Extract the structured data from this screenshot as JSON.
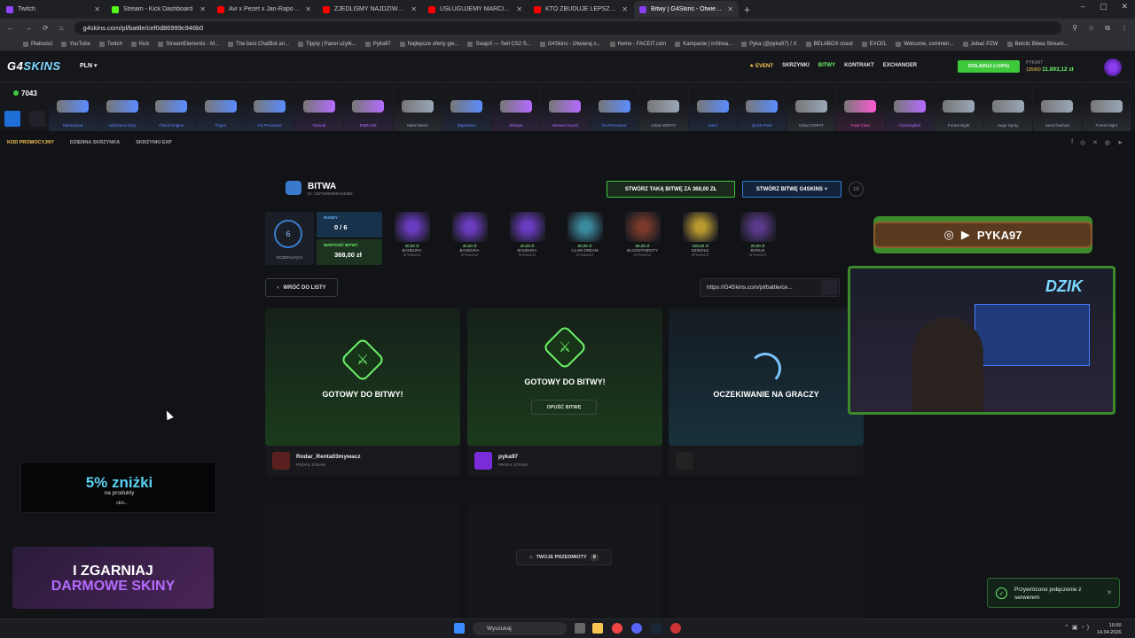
{
  "browser": {
    "tabs": [
      {
        "label": "Twitch",
        "color": "#9146ff",
        "active": false
      },
      {
        "label": "Stream - Kick Dashboard",
        "color": "#53fc18",
        "active": false
      },
      {
        "label": "Avi x Pezet x Jan-Rapowanie",
        "color": "#ff0000",
        "active": false
      },
      {
        "label": "ZJEDLIŚMY NAJDZIWNIEJSZA",
        "color": "#ff0000",
        "active": false
      },
      {
        "label": "USŁUGUJEMY MARCINOWI NA",
        "color": "#ff0000",
        "active": false
      },
      {
        "label": "KTO ZBUDUJE LEPSZĄ RZECZ",
        "color": "#ff0000",
        "active": false
      },
      {
        "label": "Bitwy | G4Skins - Otwieraj skrz",
        "color": "#8a3cf0",
        "active": true
      }
    ],
    "url": "g4skins.com/pl/battle/cef0d86999c946b0",
    "bookmarks": [
      "Płatności",
      "YouTube",
      "Twitch",
      "Kick",
      "StreamElements - M...",
      "The best ChatBot an...",
      "Tipply | Panel użytk...",
      "Pyka97",
      "Najlepsze oferty gie...",
      "SwapX — Sell CS2 S...",
      "G4Skins - Otwieraj s...",
      "Home - FACEIT.com",
      "Kampanie | inStrea...",
      "Pyka (@pyka97) / X",
      "BELABOX cloud",
      "EXCEL",
      "Welcome, commen...",
      "Jebać PZW",
      "Betclic Bitwa Stream..."
    ]
  },
  "site": {
    "logo_a": "G4",
    "logo_b": "SKINS",
    "currency": "PLN ▾",
    "nav": {
      "event": "★ EVENT",
      "cases": "SKRZYNKI",
      "battles": "BITWY",
      "contracts": "KONTRAKT",
      "exchanger": "EXCHANGER"
    },
    "topup": "DOŁADUJ (+10%)",
    "user": {
      "name": "PYKA97",
      "points": "135960",
      "balance": "11.893,12 zł"
    },
    "online": "7043",
    "ticker_items": [
      {
        "name": "Memorized",
        "color": "#5a8cff"
      },
      {
        "name": "VariCamo Grey",
        "color": "#5a8cff"
      },
      {
        "name": "Check Engine",
        "color": "#5a8cff"
      },
      {
        "name": "Trigon",
        "color": "#5a8cff"
      },
      {
        "name": "Co-Processor",
        "color": "#5a8cff"
      },
      {
        "name": "Tactical",
        "color": "#b56bff"
      },
      {
        "name": "ENRAGE",
        "color": "#b56bff"
      },
      {
        "name": "Safari Mesh",
        "color": "#9aa7b8"
      },
      {
        "name": "Slipstream",
        "color": "#5a8cff"
      },
      {
        "name": "Sharpie",
        "color": "#b56bff"
      },
      {
        "name": "Heaven Guard",
        "color": "#b56bff"
      },
      {
        "name": "Co-Processor",
        "color": "#5a8cff"
      },
      {
        "name": "Urban DDPAT",
        "color": "#9aa7b8"
      },
      {
        "name": "Kami",
        "color": "#5a8cff"
      },
      {
        "name": "Quick Peek",
        "color": "#5a8cff"
      },
      {
        "name": "Urban DDPAT",
        "color": "#9aa7b8"
      },
      {
        "name": "Fowl Clow",
        "color": "#ff5ad6"
      },
      {
        "name": "Clockingbird",
        "color": "#b56bff"
      },
      {
        "name": "Forest Night",
        "color": "#9aa7b8"
      },
      {
        "name": "Sage Spray",
        "color": "#9aa7b8"
      },
      {
        "name": "Sand Dashed",
        "color": "#9aa7b8"
      },
      {
        "name": "Forest Night",
        "color": "#9aa7b8"
      }
    ],
    "subnav": {
      "promo": "KOD PROMOCYJNY",
      "daily": "DZIENNA SKRZYNKA",
      "exp": "SKRZYNKI EXP"
    }
  },
  "battle": {
    "title": "BITWA",
    "id": "ID: CEF0D86999C946B0",
    "create_same": "STWÓRZ TAKĄ BITWĘ ZA 368,00 ZŁ",
    "create_g4": "STWÓRZ BITWĘ G4SKINS +",
    "age_badge": "18",
    "status": "OCZEKUJĄCA",
    "status_num": "6",
    "rounds_label": "RUNDY",
    "rounds_value": "0 / 6",
    "value_label": "WARTOŚĆ BITWY",
    "value_value": "368,00 zł",
    "cases": [
      {
        "name": "BANDURA",
        "price": "40,00 zł",
        "color": "#6a3cc0"
      },
      {
        "name": "BANDURA",
        "price": "40,00 zł",
        "color": "#6a3cc0"
      },
      {
        "name": "BANDURA",
        "price": "40,00 zł",
        "color": "#6a3cc0"
      },
      {
        "name": "CLAW DREAM",
        "price": "60,00 zł",
        "color": "#3a8a9c"
      },
      {
        "name": "BLOODTHIRSTY",
        "price": "68,00 zł",
        "color": "#7a3a2a"
      },
      {
        "name": "DZINOLD",
        "price": "100,00 zł",
        "color": "#b89a30"
      },
      {
        "name": "BONUS",
        "price": "20,00 zł",
        "color": "#5a3a8a"
      }
    ],
    "check_label": "SPRAWDŹ",
    "back": "WRÓĆ DO LISTY",
    "link": "https://G4Skins.com/pl/battle/ce...",
    "slots": [
      {
        "title": "GOTOWY DO BITWY!",
        "player": "Rodar_Renta03mywacz",
        "profile": "PROFIL STEAM"
      },
      {
        "title": "GOTOWY DO BITWY!",
        "player": "pyka97",
        "profile": "PROFIL STEAM",
        "leave": "OPUŚĆ BITWĘ"
      },
      {
        "title": "OCZEKIWANIE NA GRACZY"
      }
    ]
  },
  "overlay": {
    "promo_big": "5% zniżki",
    "promo_small": "na produkty",
    "promo_small2": "ob/s..",
    "promo2_a": "I ZGARNIAJ",
    "promo2_b": "DARMOWE SKINY",
    "handle": "PYKA97",
    "cam_logo": "DZIK"
  },
  "toast": "Przywrócono połączenie z serwerem",
  "my_items": {
    "label": "TWOJE PRZEDMIOTY",
    "count": "0"
  },
  "taskbar": {
    "search": "Wyszukaj",
    "time": "16:00",
    "date": "14.04.2026"
  }
}
